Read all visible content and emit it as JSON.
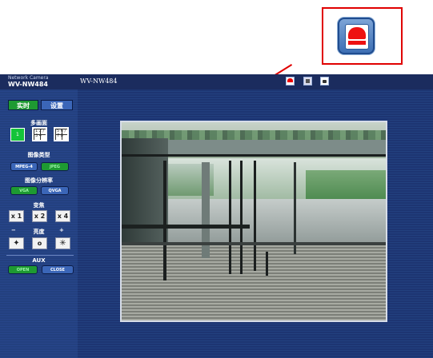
{
  "header": {
    "brand_small": "Network Camera",
    "model": "WV-NW484",
    "title": "WV-NW484",
    "icons": [
      "alarm-icon",
      "sd-card-icon",
      "camera-snapshot-icon"
    ]
  },
  "sidebar": {
    "tabs": [
      {
        "label": "实时",
        "active": true
      },
      {
        "label": "设置",
        "active": false
      }
    ],
    "multiscreen": {
      "label": "多画面",
      "buttons": [
        {
          "label": "1",
          "active": true
        },
        {
          "label": "1 2 / 3 4",
          "active": false
        },
        {
          "label": "5 6 / 7 8",
          "active": false
        }
      ]
    },
    "image_type": {
      "label": "图像类型",
      "options": [
        {
          "label": "MPEG-4",
          "active": false
        },
        {
          "label": "JPEG",
          "active": true
        }
      ]
    },
    "resolution": {
      "label": "图像分辨率",
      "options": [
        {
          "label": "VGA",
          "active": true
        },
        {
          "label": "QVGA",
          "active": false
        }
      ]
    },
    "zoom": {
      "label": "变焦",
      "buttons": [
        "x 1",
        "x 2",
        "x 4"
      ]
    },
    "brightness": {
      "label": "亮度",
      "minus": "−",
      "plus": "+",
      "buttons": [
        "dark",
        "o",
        "bright"
      ]
    },
    "aux": {
      "label": "AUX",
      "open": "OPEN",
      "close": "CLOSE"
    }
  },
  "colors": {
    "header": "#1b2c5e",
    "sidebar": "#23407f",
    "active_green": "#1e9a32",
    "inactive_blue": "#3b66b8",
    "callout": "#e00000"
  }
}
